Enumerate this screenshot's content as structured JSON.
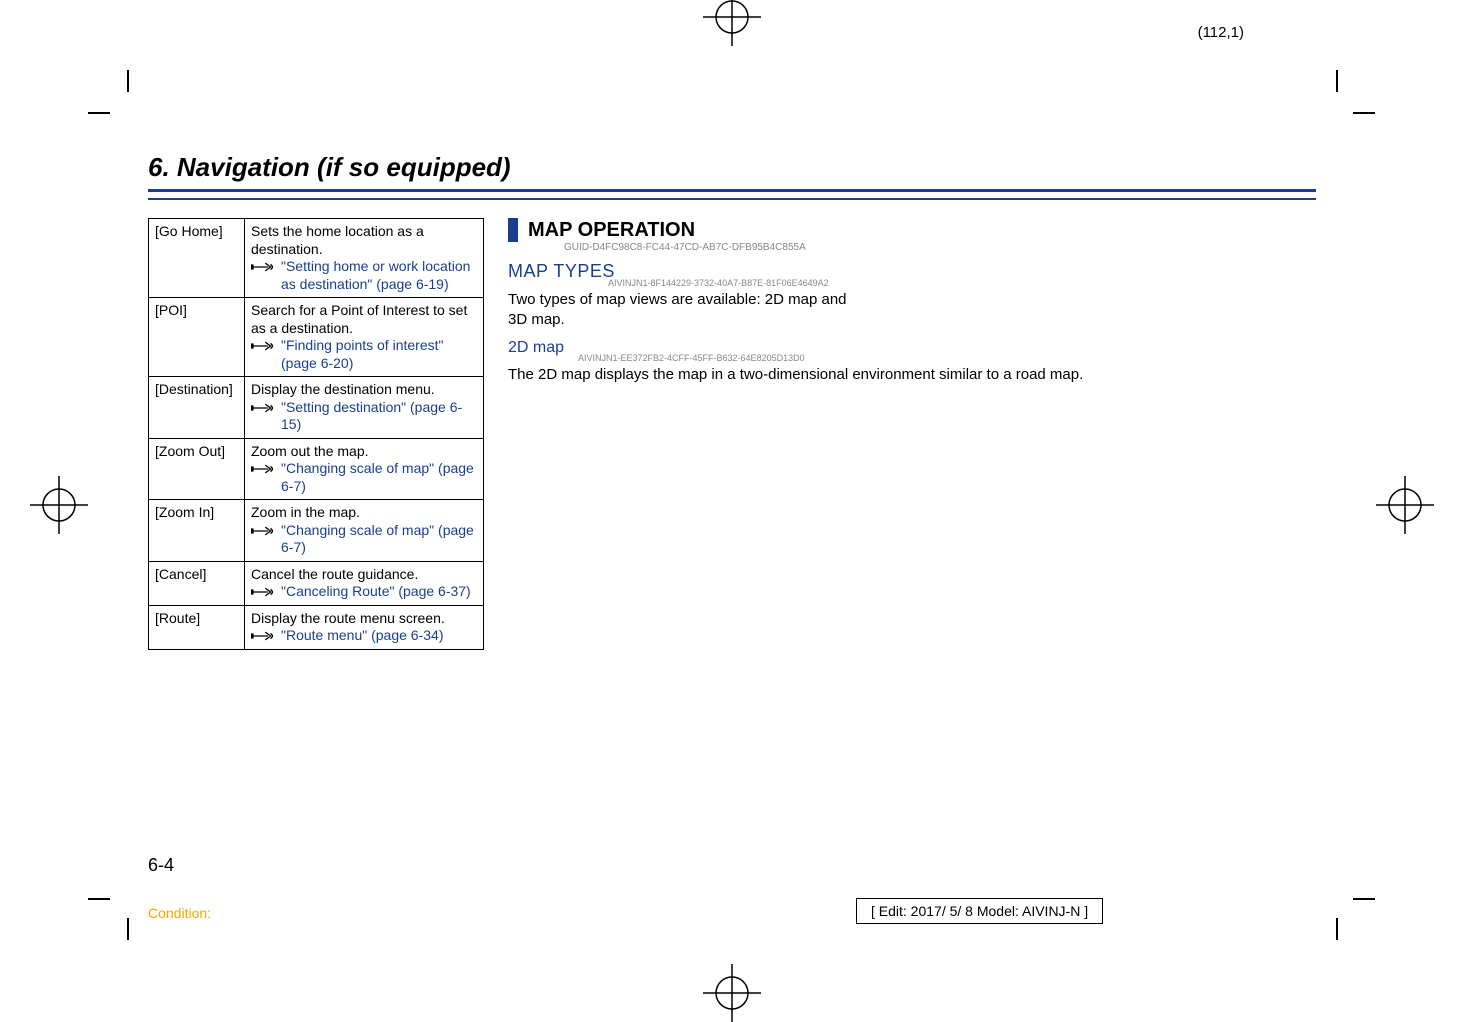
{
  "page_coord": "(112,1)",
  "chapter_title": "6. Navigation (if so equipped)",
  "table": {
    "rows": [
      {
        "key": "[Go Home]",
        "desc": "Sets the home location as a destination.",
        "link": "\"Setting home or work location as destination\" (page 6-19)"
      },
      {
        "key": "[POI]",
        "desc": "Search for a Point of Interest to set as a destination.",
        "link": "\"Finding points of interest\" (page 6-20)"
      },
      {
        "key": "[Destination]",
        "desc": "Display the destination menu.",
        "link": "\"Setting destination\" (page 6-15)"
      },
      {
        "key": "[Zoom Out]",
        "desc": "Zoom out the map.",
        "link": "\"Changing scale of map\" (page 6-7)"
      },
      {
        "key": "[Zoom In]",
        "desc": "Zoom in the map.",
        "link": "\"Changing scale of map\" (page 6-7)"
      },
      {
        "key": "[Cancel]",
        "desc": "Cancel the route guidance.",
        "link": "\"Canceling Route\" (page 6-37)"
      },
      {
        "key": "[Route]",
        "desc": "Display the route menu screen.",
        "link": "\"Route menu\" (page 6-34)"
      }
    ]
  },
  "right": {
    "section_title": "MAP OPERATION",
    "section_guid": "GUID-D4FC98C8-FC44-47CD-AB7C-DFB95B4C855A",
    "map_types_heading": "MAP TYPES",
    "map_types_guid": "AIVINJN1-8F144229-3732-40A7-B87E-81F06E4649A2",
    "map_types_body": "Two types of map views are available: 2D map and 3D map.",
    "map2d_heading": "2D map",
    "map2d_guid": "AIVINJN1-EE372FB2-4CFF-45FF-B632-64E8205D13D0",
    "map2d_body": "The 2D map displays the map in a two-dimensional environment similar to a road map."
  },
  "page_number": "6-4",
  "condition_label": "Condition:",
  "edit_box": "[ Edit: 2017/ 5/ 8    Model:  AIVINJ-N ]"
}
